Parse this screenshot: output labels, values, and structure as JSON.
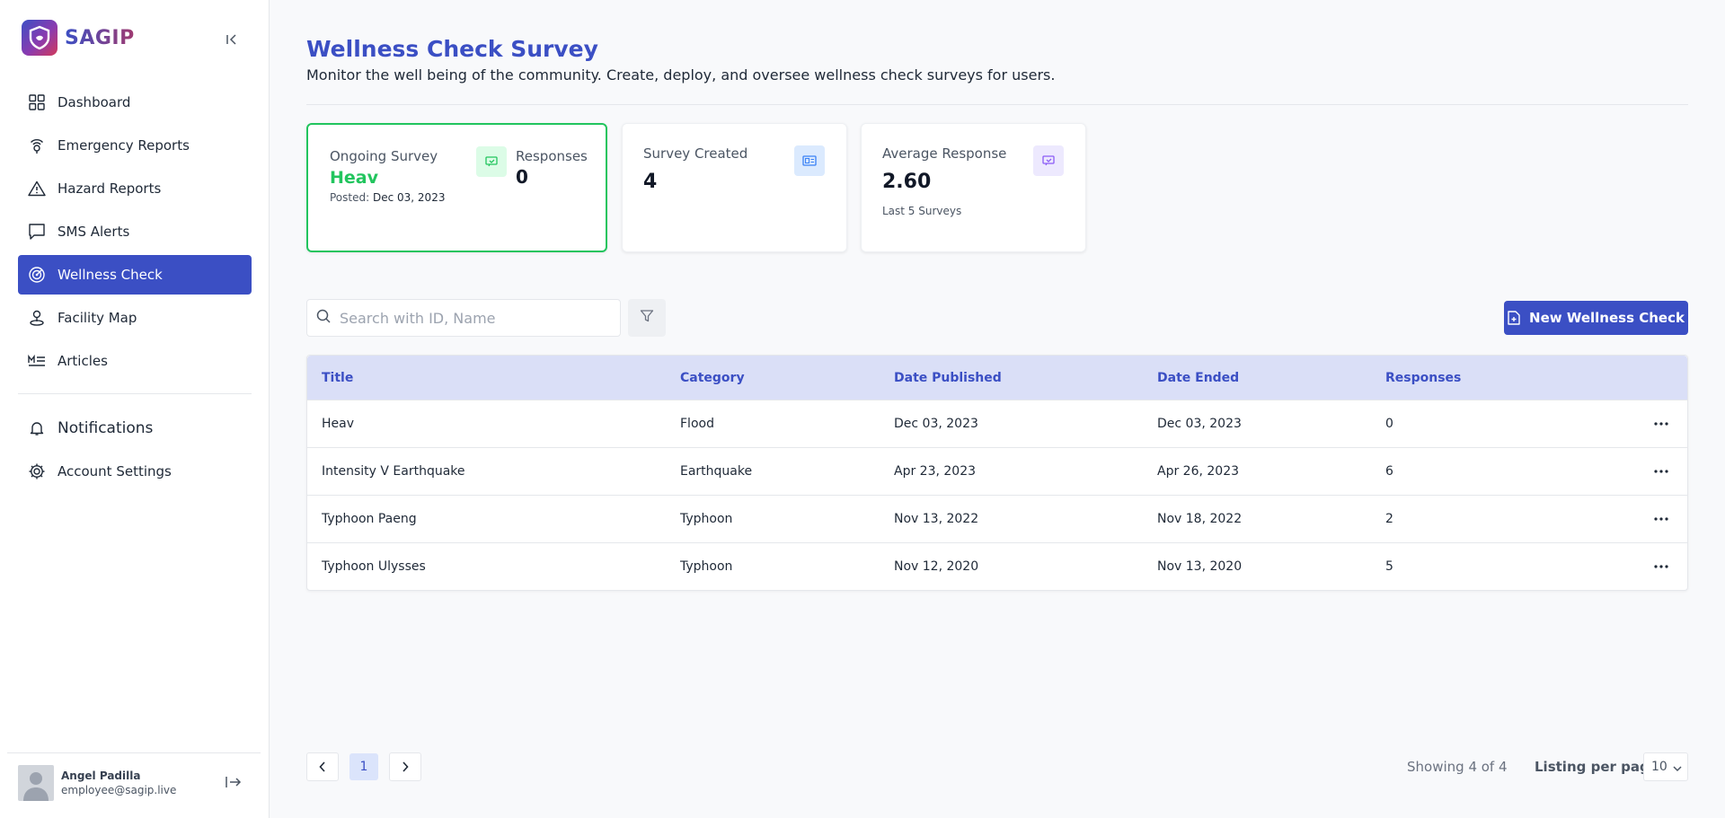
{
  "brand": {
    "name": "SAGIP"
  },
  "sidebar": {
    "items": [
      {
        "label": "Dashboard",
        "icon": "grid-icon"
      },
      {
        "label": "Emergency Reports",
        "icon": "signal-pin-icon"
      },
      {
        "label": "Hazard Reports",
        "icon": "warning-icon"
      },
      {
        "label": "SMS Alerts",
        "icon": "chat-icon"
      },
      {
        "label": "Wellness Check",
        "icon": "radar-icon",
        "active": true
      },
      {
        "label": "Facility Map",
        "icon": "map-pin-icon"
      },
      {
        "label": "Articles",
        "icon": "markdown-icon"
      }
    ],
    "secondary": [
      {
        "label": "Notifications",
        "icon": "bell-icon"
      },
      {
        "label": "Account Settings",
        "icon": "gear-icon"
      }
    ]
  },
  "user": {
    "name": "Angel Padilla",
    "email": "employee@sagip.live"
  },
  "header": {
    "title": "Wellness Check Survey",
    "subtitle": "Monitor the well being of the community. Create, deploy, and oversee wellness check surveys for users."
  },
  "cards": {
    "ongoing": {
      "label": "Ongoing Survey",
      "title": "Heav",
      "posted_label": "Posted:",
      "posted_date": "Dec 03, 2023",
      "responses_label": "Responses",
      "responses_value": "0"
    },
    "created": {
      "label": "Survey Created",
      "value": "4"
    },
    "average": {
      "label": "Average Response",
      "value": "2.60",
      "note": "Last 5 Surveys"
    }
  },
  "search": {
    "placeholder": "Search with ID, Name",
    "value": ""
  },
  "new_button": {
    "label": "New Wellness Check"
  },
  "table": {
    "headers": [
      "Title",
      "Category",
      "Date Published",
      "Date Ended",
      "Responses"
    ],
    "rows": [
      {
        "title": "Heav",
        "category": "Flood",
        "published": "Dec 03, 2023",
        "ended": "Dec 03, 2023",
        "responses": "0"
      },
      {
        "title": "Intensity V Earthquake",
        "category": "Earthquake",
        "published": "Apr 23, 2023",
        "ended": "Apr 26, 2023",
        "responses": "6"
      },
      {
        "title": "Typhoon Paeng",
        "category": "Typhoon",
        "published": "Nov 13, 2022",
        "ended": "Nov 18, 2022",
        "responses": "2"
      },
      {
        "title": "Typhoon Ulysses",
        "category": "Typhoon",
        "published": "Nov 12, 2020",
        "ended": "Nov 13, 2020",
        "responses": "5"
      }
    ]
  },
  "pagination": {
    "current_page": "1",
    "showing": "Showing 4 of 4",
    "per_page_label": "Listing per page",
    "per_page_value": "10"
  },
  "colors": {
    "accent": "#3b4fc4",
    "success": "#22c55e",
    "header_bg": "#dadff7"
  }
}
